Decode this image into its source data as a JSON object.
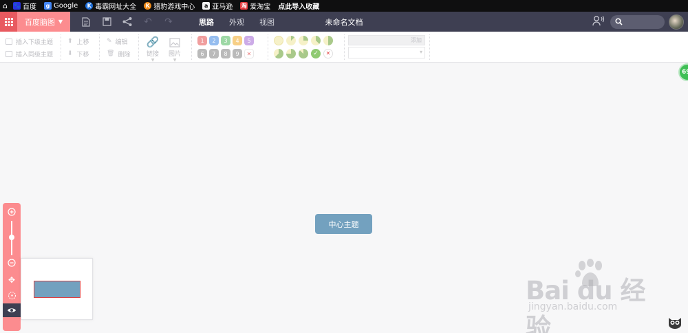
{
  "bookmarks": {
    "items": [
      {
        "label": "百度",
        "icon": "baidu-icon",
        "color": "#2932e1"
      },
      {
        "label": "Google",
        "icon": "google-icon",
        "color": "#4285f4"
      },
      {
        "label": "毒霸网址大全",
        "icon": "duba-icon",
        "color": "#1e6fd9"
      },
      {
        "label": "猎豹游戏中心",
        "icon": "liebao-icon",
        "color": "#f08c1a"
      },
      {
        "label": "亚马逊",
        "icon": "amazon-icon",
        "color": "#f3f3f3"
      },
      {
        "label": "爱淘宝",
        "icon": "taobao-icon",
        "color": "#e4393c"
      },
      {
        "label": "点此导入收藏",
        "icon": "",
        "color": ""
      }
    ]
  },
  "topbar": {
    "brand": "百度脑图",
    "tabs": [
      "思路",
      "外观",
      "视图"
    ],
    "active_tab": "思路",
    "doc_title": "未命名文档",
    "accent": "#fc8c8f",
    "bg": "#3e3f52"
  },
  "ribbon": {
    "insert_child": "插入下级主题",
    "insert_sibling": "插入同级主题",
    "move_up": "上移",
    "move_down": "下移",
    "edit": "编辑",
    "delete": "删除",
    "link": "链接",
    "image": "图片",
    "priorities": [
      "1",
      "2",
      "3",
      "4",
      "5",
      "6",
      "7",
      "8",
      "9"
    ],
    "priority_colors": [
      "#e24040",
      "#2d7ee0",
      "#3db34d",
      "#f0a010",
      "#9b59d0",
      "#777777",
      "#777777",
      "#777777",
      "#777777"
    ],
    "resource_add": "添加"
  },
  "canvas": {
    "central_topic": "中心主题",
    "badge": "69"
  },
  "watermark": {
    "brand": "Bai du 经验",
    "url": "jingyan.baidu.com"
  }
}
